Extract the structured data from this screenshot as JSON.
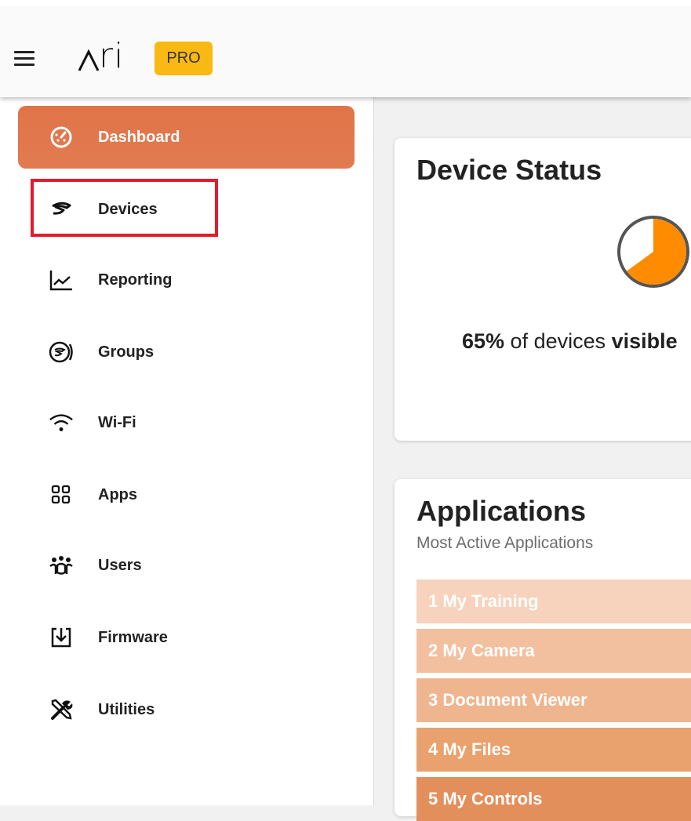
{
  "header": {
    "logo_text": "ri",
    "badge": "PRO"
  },
  "sidebar": {
    "items": [
      {
        "label": "Dashboard",
        "icon": "dashboard-gauge-icon",
        "active": true
      },
      {
        "label": "Devices",
        "icon": "devices-icon"
      },
      {
        "label": "Reporting",
        "icon": "line-chart-icon"
      },
      {
        "label": "Groups",
        "icon": "groups-icon"
      },
      {
        "label": "Wi-Fi",
        "icon": "wifi-icon"
      },
      {
        "label": "Apps",
        "icon": "apps-grid-icon"
      },
      {
        "label": "Users",
        "icon": "users-icon"
      },
      {
        "label": "Firmware",
        "icon": "download-icon"
      },
      {
        "label": "Utilities",
        "icon": "tools-icon"
      }
    ]
  },
  "device_status": {
    "title": "Device Status",
    "percent": "65%",
    "percent_value": 65,
    "text_mid": " of devices ",
    "text_bold": "visible"
  },
  "applications": {
    "title": "Applications",
    "subtitle": "Most Active Applications",
    "rows": [
      {
        "label": "1  My Training",
        "color": "#f7d3bd"
      },
      {
        "label": "2  My Camera",
        "color": "#f3c09f"
      },
      {
        "label": "3  Document Viewer",
        "color": "#efb58f"
      },
      {
        "label": "4  My Files",
        "color": "#e9a26d"
      },
      {
        "label": "5  My Controls",
        "color": "#e38f5c"
      }
    ]
  },
  "colors": {
    "accent": "#e07447",
    "badge": "#f9b912",
    "highlight": "#e21c2b",
    "pie_fill": "#ff8c00"
  }
}
